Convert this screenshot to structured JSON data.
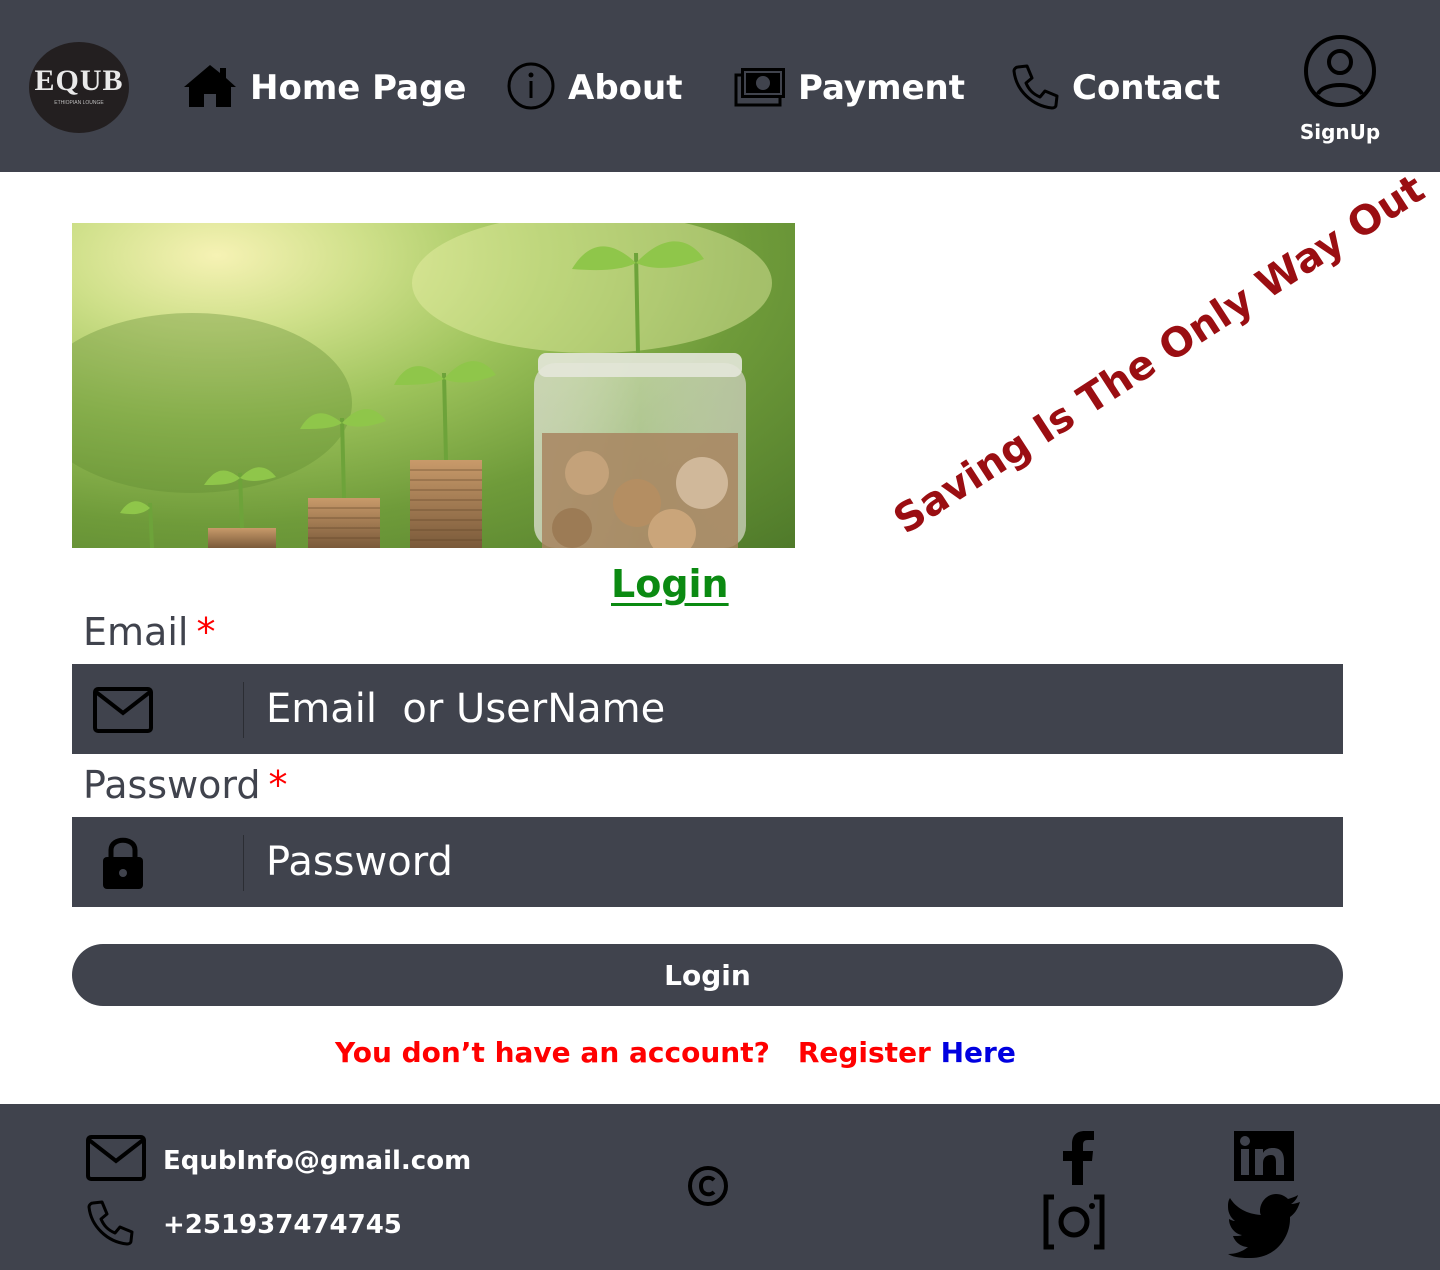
{
  "header": {
    "logo_text": "EQUB",
    "logo_subtext": "ETHIOPIAN LOUNGE",
    "nav": [
      {
        "label": "Home Page",
        "icon": "home-icon"
      },
      {
        "label": "About",
        "icon": "info-icon"
      },
      {
        "label": "Payment",
        "icon": "money-icon"
      },
      {
        "label": "Contact",
        "icon": "phone-icon"
      }
    ],
    "signup_label": "SignUp"
  },
  "hero": {
    "slogan": "Saving Is The Only Way Out"
  },
  "form": {
    "title": "Login",
    "email_label": "Email",
    "email_placeholder": "Email  or UserName",
    "password_label": "Password",
    "password_placeholder": "Password",
    "required_marker": "*",
    "login_button": "Login",
    "no_account_text": "You don’t have an account?",
    "register_text": "Register",
    "here_text": "Here"
  },
  "footer": {
    "email": "EqubInfo@gmail.com",
    "phone": "+251937474745",
    "social": [
      "facebook-icon",
      "linkedin-icon",
      "instagram-icon",
      "twitter-icon"
    ]
  },
  "colors": {
    "bar": "#40434d",
    "slogan": "#9a0e12",
    "title": "#0b8a12",
    "required": "#ff0000",
    "link": "#0000e0"
  }
}
